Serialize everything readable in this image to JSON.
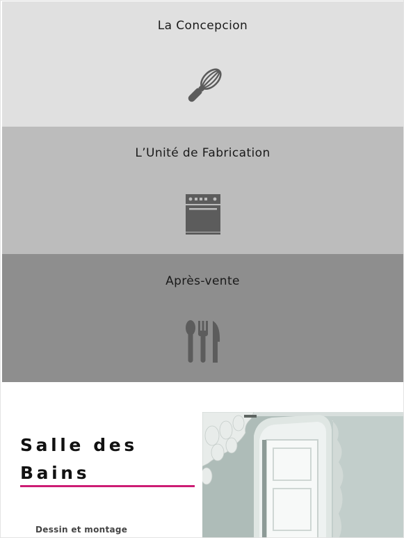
{
  "services": [
    {
      "title": "La Concepcion",
      "icon": "whisk-icon"
    },
    {
      "title": "L’Unité de Fabrication",
      "icon": "oven-icon"
    },
    {
      "title": "Après-vente",
      "icon": "cutlery-icon"
    }
  ],
  "bath_section": {
    "title_line1": "Salle des",
    "title_line2": "Bains",
    "subtitle": "Dessin et montage",
    "accent_color": "#cc1c74",
    "image": "bathroom-mirror-photo"
  },
  "colors": {
    "band_light": "#e0e0e0",
    "band_mid": "#bcbcbc",
    "band_dark": "#8e8e8e",
    "icon_fill": "#5c5c5c"
  }
}
